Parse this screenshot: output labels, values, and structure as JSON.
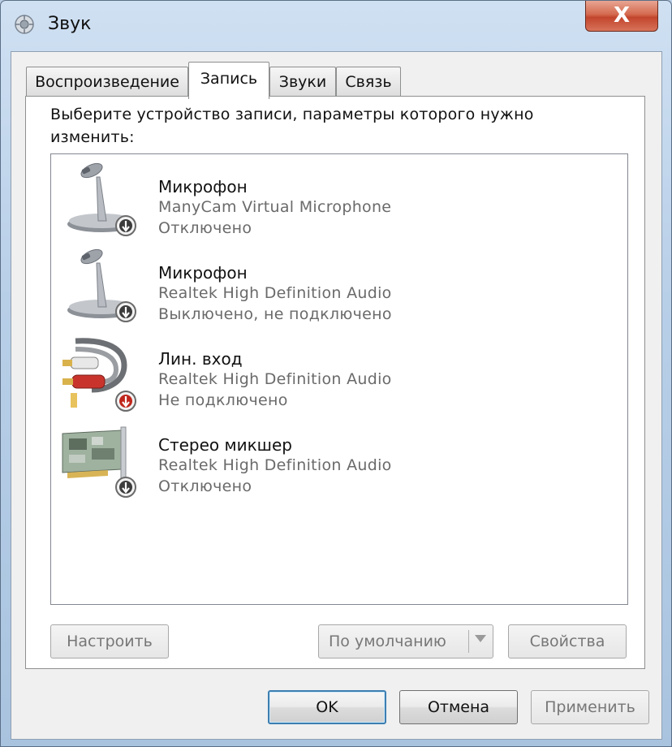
{
  "window": {
    "title": "Звук",
    "close_label": "X"
  },
  "tabs": [
    {
      "label": "Воспроизведение",
      "active": false
    },
    {
      "label": "Запись",
      "active": true
    },
    {
      "label": "Звуки",
      "active": false
    },
    {
      "label": "Связь",
      "active": false
    }
  ],
  "instruction": "Выберите устройство записи, параметры которого нужно изменить:",
  "devices": [
    {
      "name": "Микрофон",
      "driver": "ManyCam Virtual Microphone",
      "status": "Отключено",
      "icon": "microphone-icon",
      "badge": "down-arrow-badge"
    },
    {
      "name": "Микрофон",
      "driver": "Realtek High Definition Audio",
      "status": "Выключено, не подключено",
      "icon": "microphone-icon",
      "badge": "down-arrow-badge"
    },
    {
      "name": "Лин. вход",
      "driver": "Realtek High Definition Audio",
      "status": "Не подключено",
      "icon": "rca-cable-icon",
      "badge": "red-down-arrow-badge"
    },
    {
      "name": "Стерео микшер",
      "driver": "Realtek High Definition Audio",
      "status": "Отключено",
      "icon": "sound-card-icon",
      "badge": "down-arrow-badge"
    }
  ],
  "buttons": {
    "configure": "Настроить",
    "set_default": "По умолчанию",
    "properties": "Свойства",
    "ok": "OK",
    "cancel": "Отмена",
    "apply": "Применить"
  },
  "colors": {
    "close_button": "#c94a31",
    "default_button_border": "#3c7fb1",
    "badge_red": "#c0261c"
  }
}
